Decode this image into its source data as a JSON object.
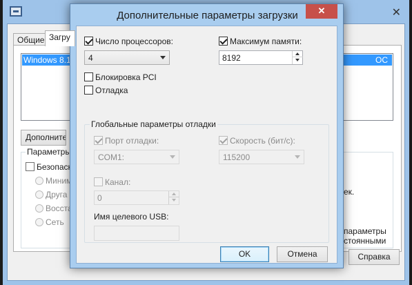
{
  "background_window": {
    "tabs": [
      "Общие",
      "Загру"
    ],
    "os_list_selected": "Windows 8.1",
    "os_list_selected_suffix": "ОС",
    "advanced_button": "Дополнительн",
    "params_group_title": "Параметры",
    "safe_boot_label": "Безопасн",
    "radio_options": [
      "Миним",
      "Друга",
      "Восста",
      "Сеть"
    ],
    "right_text_1": "ек.",
    "right_text_2": "параметры",
    "right_text_3": "стоянными",
    "help_button": "Справка",
    "close_glyph": "✕"
  },
  "dialog": {
    "title": "Дополнительные параметры загрузки",
    "close_glyph": "✕",
    "processors_checkbox": {
      "label": "Число процессоров:",
      "checked": true
    },
    "processors_combo": {
      "value": "4"
    },
    "max_memory_checkbox": {
      "label": "Максимум памяти:",
      "checked": true
    },
    "max_memory_spin": {
      "value": "8192"
    },
    "pci_lock": {
      "label": "Блокировка PCI",
      "checked": false
    },
    "debug": {
      "label": "Отладка",
      "checked": false
    },
    "debug_group": {
      "title": "Глобальные параметры отладки",
      "debug_port": {
        "label": "Порт отладки:",
        "checked": true,
        "value": "COM1:"
      },
      "baud_rate": {
        "label": "Скорость (бит/с):",
        "checked": true,
        "value": "115200"
      },
      "channel": {
        "label": "Канал:",
        "checked": false,
        "value": "0"
      },
      "usb_target_label": "Имя целевого USB:",
      "usb_target_value": ""
    },
    "ok_button": "OK",
    "cancel_button": "Отмена"
  },
  "colors": {
    "title_bar": "#a9cdef",
    "close_button": "#c7504a",
    "selection": "#3399ff",
    "disabled_text": "#8a8a8a"
  }
}
